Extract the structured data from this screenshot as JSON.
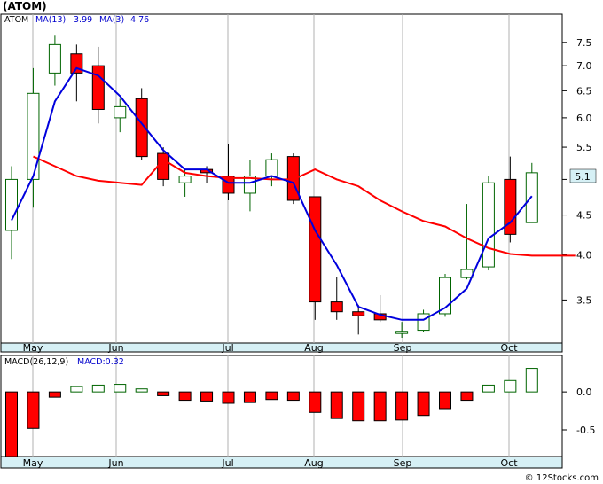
{
  "header": {
    "title": "(ATOM)",
    "ma_fast_label": "MA(13)",
    "ma_fast_value": "3.99",
    "ma_slow_label": "MA(3)",
    "ma_slow_value": "4.76",
    "macd_label": "MACD(26,12,9)",
    "macd_value_label": "MACD:0.32",
    "last_price_badge": "5.1",
    "watermark": "© 12Stocks.com"
  },
  "colors": {
    "up": "#006400",
    "down": "#ff0000",
    "ma_fast": "#ff0000",
    "ma_slow": "#0000dd",
    "badge_fill": "#d6f0f5",
    "axis_band": "#d6f0f5"
  },
  "chart_data": [
    {
      "type": "candlestick",
      "title": "(ATOM)",
      "x_labels": [
        "May",
        "Jun",
        "Jul",
        "Aug",
        "Sep",
        "Oct"
      ],
      "y_ticks": [
        "7.5",
        "7.0",
        "6.5",
        "6.0",
        "5.5",
        "5.0",
        "4.5",
        "4.0",
        "3.5"
      ],
      "y_scale": "log",
      "ylim": [
        3.13,
        7.9
      ],
      "candles": [
        {
          "open": 4.3,
          "high": 5.2,
          "low": 3.95,
          "close": 5.0
        },
        {
          "open": 5.0,
          "high": 6.95,
          "low": 4.6,
          "close": 6.45
        },
        {
          "open": 6.85,
          "high": 7.65,
          "low": 6.6,
          "close": 7.45
        },
        {
          "open": 7.25,
          "high": 7.45,
          "low": 6.3,
          "close": 6.85
        },
        {
          "open": 7.0,
          "high": 7.4,
          "low": 5.9,
          "close": 6.15
        },
        {
          "open": 6.0,
          "high": 6.35,
          "low": 5.75,
          "close": 6.2
        },
        {
          "open": 6.35,
          "high": 6.55,
          "low": 5.3,
          "close": 5.35
        },
        {
          "open": 5.4,
          "high": 5.5,
          "low": 4.9,
          "close": 5.0
        },
        {
          "open": 4.95,
          "high": 5.15,
          "low": 4.75,
          "close": 5.05
        },
        {
          "open": 5.15,
          "high": 5.2,
          "low": 4.95,
          "close": 5.1
        },
        {
          "open": 5.05,
          "high": 5.55,
          "low": 4.7,
          "close": 4.8
        },
        {
          "open": 4.8,
          "high": 5.3,
          "low": 4.55,
          "close": 5.05
        },
        {
          "open": 5.05,
          "high": 5.4,
          "low": 4.9,
          "close": 5.3
        },
        {
          "open": 5.35,
          "high": 5.4,
          "low": 4.65,
          "close": 4.7
        },
        {
          "open": 4.75,
          "high": 4.75,
          "low": 3.3,
          "close": 3.48
        },
        {
          "open": 3.48,
          "high": 3.75,
          "low": 3.3,
          "close": 3.38
        },
        {
          "open": 3.38,
          "high": 3.45,
          "low": 3.16,
          "close": 3.34
        },
        {
          "open": 3.36,
          "high": 3.55,
          "low": 3.28,
          "close": 3.3
        },
        {
          "open": 3.17,
          "high": 3.28,
          "low": 3.13,
          "close": 3.19
        },
        {
          "open": 3.2,
          "high": 3.4,
          "low": 3.18,
          "close": 3.36
        },
        {
          "open": 3.36,
          "high": 3.78,
          "low": 3.33,
          "close": 3.74
        },
        {
          "open": 3.74,
          "high": 4.65,
          "low": 3.72,
          "close": 3.83
        },
        {
          "open": 3.86,
          "high": 5.05,
          "low": 3.82,
          "close": 4.95
        },
        {
          "open": 5.0,
          "high": 5.35,
          "low": 4.15,
          "close": 4.25
        },
        {
          "open": 4.4,
          "high": 5.25,
          "low": 4.4,
          "close": 5.1
        }
      ],
      "series": [
        {
          "name": "MA(13)",
          "values": [
            null,
            5.35,
            5.2,
            5.05,
            4.98,
            4.95,
            4.92,
            5.3,
            5.1,
            5.05,
            5.02,
            5.02,
            5.0,
            5.0,
            5.15,
            5.0,
            4.9,
            4.7,
            4.55,
            4.42,
            4.35,
            4.2,
            4.08,
            4.01,
            3.99,
            3.99,
            3.99
          ]
        },
        {
          "name": "MA(3)",
          "values": [
            4.43,
            5.05,
            6.3,
            6.95,
            6.8,
            6.4,
            5.9,
            5.45,
            5.15,
            5.15,
            4.95,
            4.95,
            5.05,
            4.95,
            4.3,
            3.88,
            3.43,
            3.35,
            3.3,
            3.3,
            3.42,
            3.62,
            4.2,
            4.4,
            4.76
          ]
        }
      ]
    },
    {
      "type": "bar",
      "title": "MACD(26,12,9)",
      "x_labels": [
        "May",
        "Jun",
        "Jul",
        "Aug",
        "Sep",
        "Oct"
      ],
      "y_ticks": [
        "0.0",
        "-0.5"
      ],
      "ylim": [
        -0.85,
        0.48
      ],
      "values": [
        -0.85,
        -0.48,
        -0.07,
        0.07,
        0.09,
        0.1,
        0.04,
        -0.05,
        -0.11,
        -0.12,
        -0.15,
        -0.14,
        -0.1,
        -0.11,
        -0.27,
        -0.35,
        -0.38,
        -0.38,
        -0.37,
        -0.31,
        -0.22,
        -0.11,
        0.09,
        0.15,
        0.31
      ]
    }
  ]
}
